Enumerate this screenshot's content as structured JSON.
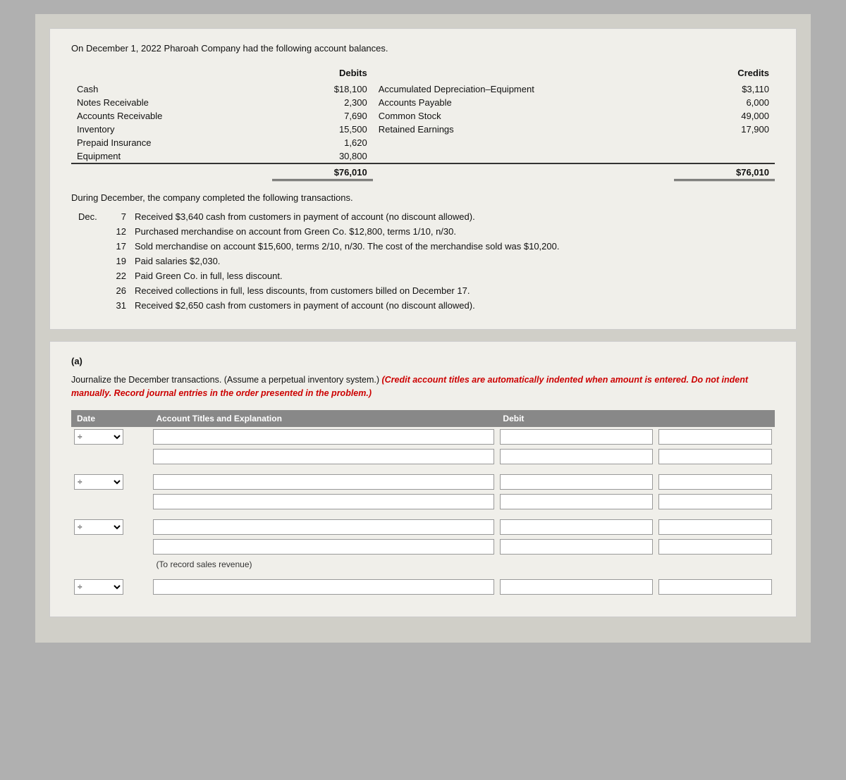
{
  "intro": {
    "text": "On December 1, 2022 Pharoah Company had the following account balances."
  },
  "balance_table": {
    "headers": {
      "debits": "Debits",
      "credits": "Credits"
    },
    "debit_accounts": [
      {
        "name": "Cash",
        "value": "$18,100"
      },
      {
        "name": "Notes Receivable",
        "value": "2,300"
      },
      {
        "name": "Accounts Receivable",
        "value": "7,690"
      },
      {
        "name": "Inventory",
        "value": "15,500"
      },
      {
        "name": "Prepaid Insurance",
        "value": "1,620"
      },
      {
        "name": "Equipment",
        "value": "30,800"
      }
    ],
    "debit_total": "$76,010",
    "credit_accounts": [
      {
        "name": "Accumulated Depreciation–Equipment",
        "value": "$3,110"
      },
      {
        "name": "Accounts Payable",
        "value": "6,000"
      },
      {
        "name": "Common Stock",
        "value": "49,000"
      },
      {
        "name": "Retained Earnings",
        "value": "17,900"
      }
    ],
    "credit_total": "$76,010"
  },
  "transactions": {
    "intro": "During December, the company completed the following transactions.",
    "month": "Dec.",
    "items": [
      {
        "day": "7",
        "desc": "Received $3,640 cash from customers in payment of account (no discount allowed)."
      },
      {
        "day": "12",
        "desc": "Purchased merchandise on account from Green Co. $12,800, terms 1/10, n/30."
      },
      {
        "day": "17",
        "desc": "Sold merchandise on account $15,600, terms 2/10, n/30. The cost of the merchandise sold was $10,200."
      },
      {
        "day": "19",
        "desc": "Paid salaries $2,030."
      },
      {
        "day": "22",
        "desc": "Paid Green Co. in full, less discount."
      },
      {
        "day": "26",
        "desc": "Received collections in full, less discounts, from customers billed on December 17."
      },
      {
        "day": "31",
        "desc": "Received $2,650 cash from customers in payment of account (no discount allowed)."
      }
    ]
  },
  "part_a": {
    "label": "(a)",
    "instructions_normal": "Journalize the December transactions. (Assume a perpetual inventory system.)",
    "instructions_red": "(Credit account titles are automatically indented when amount is entered. Do not indent manually. Record journal entries in the order presented in the problem.)",
    "table_headers": {
      "date": "Date",
      "account": "Account Titles and Explanation",
      "debit": "Debit",
      "credit": ""
    },
    "note": "(To record sales revenue)"
  }
}
